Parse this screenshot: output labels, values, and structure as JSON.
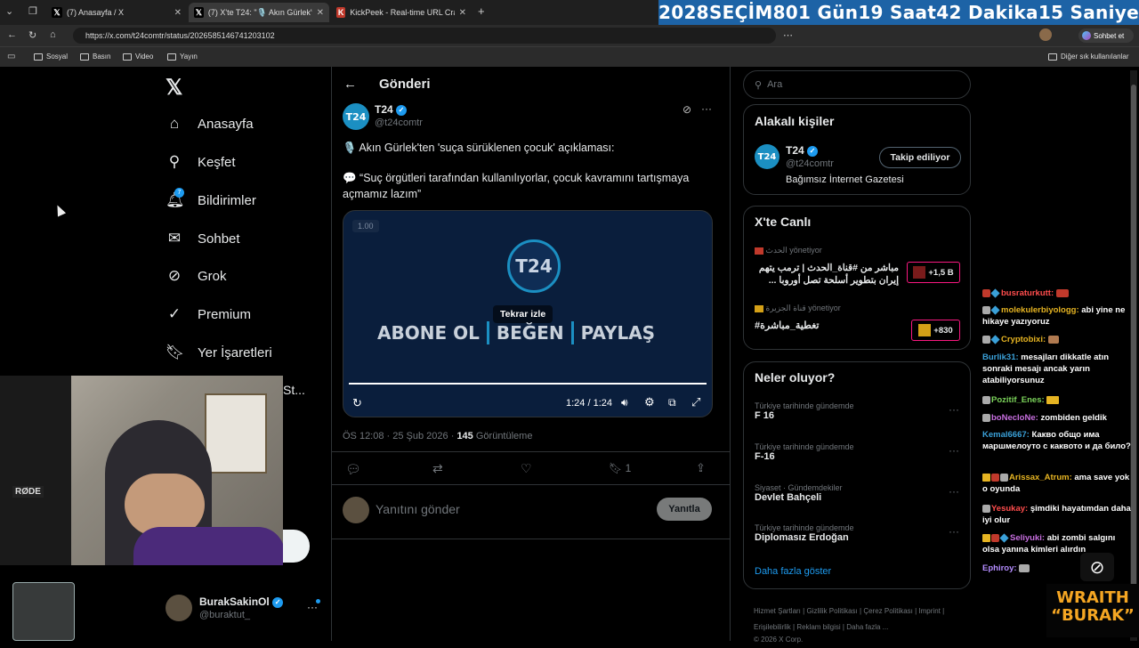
{
  "browser": {
    "tabs": [
      {
        "label": "(7) Anasayfa / X"
      },
      {
        "label": "(7) X'te T24: \"🎙️ Akın Gürlek'ten"
      },
      {
        "label": "KickPeek - Real-time URL Crawler"
      }
    ],
    "url": "https://x.com/t24comtr/status/2026585146741203102",
    "profile_button": "Sohbet et",
    "bookmarks": [
      "Sosyal",
      "Basın",
      "Video",
      "Yayın"
    ],
    "other_bookmarks": "Diğer sık kullanılanlar"
  },
  "countdown": {
    "year": "2028",
    "label": "SEÇİM",
    "days": "801 Gün",
    "hours": "19 Saat",
    "minutes": "42 Dakika",
    "seconds": "15 Saniye"
  },
  "sidebar": {
    "items": [
      {
        "label": "Anasayfa",
        "icon": "home-icon"
      },
      {
        "label": "Keşfet",
        "icon": "search-icon"
      },
      {
        "label": "Bildirimler",
        "icon": "bell-icon",
        "badge": "7"
      },
      {
        "label": "Sohbet",
        "icon": "mail-icon"
      },
      {
        "label": "Grok",
        "icon": "grok-icon"
      },
      {
        "label": "Premium",
        "icon": "premium-icon"
      },
      {
        "label": "Yer İşaretleri",
        "icon": "bookmark-icon"
      }
    ],
    "partial_item": "St...",
    "account_name": "BurakSakinOl",
    "account_handle": "@buraktut_"
  },
  "post": {
    "header": "Gönderi",
    "author_name": "T24",
    "author_handle": "@t24comtr",
    "text_line1": "🎙️ Akın Gürlek'ten 'suça sürüklenen çocuk' açıklaması:",
    "text_line2": "💬 “Suç örgütleri tarafından kullanılıyorlar, çocuk kavramını tartışmaya açmamız lazım”",
    "video": {
      "speed": "1.00",
      "logo": "T24",
      "replay_tooltip": "Tekrar izle",
      "cta1": "ABONE OL",
      "cta2": "BEĞEN",
      "cta3": "PAYLAŞ",
      "time": "1:24 / 1:24",
      "progress": 1.0
    },
    "timestamp": "ÖS 12:08 · 25 Şub 2026 ·",
    "views_count": "145",
    "views_label": "Görüntüleme",
    "bookmark_count": "1",
    "reply_placeholder": "Yanıtını gönder",
    "reply_button": "Yanıtla"
  },
  "right": {
    "search_placeholder": "Ara",
    "related_title": "Alakalı kişiler",
    "related": {
      "name": "T24",
      "handle": "@t24comtr",
      "bio": "Bağımsız İnternet Gazetesi",
      "follow_label": "Takip ediliyor"
    },
    "live_title": "X'te Canlı",
    "live": [
      {
        "host": "الحدث",
        "status": "yönetiyor",
        "title": "مباشر من #قناة_الحدث | ترمب يتهم إيران بتطوير أسلحة تصل أوروبا ...",
        "count": "+1,5 B"
      },
      {
        "host": "قناة الجزيرة",
        "status": "yönetiyor",
        "title": "#تغطية_مباشرة",
        "count": "+830"
      }
    ],
    "trends_title": "Neler oluyor?",
    "trends": [
      {
        "category": "Türkiye tarihinde gündemde",
        "name": "F 16"
      },
      {
        "category": "Türkiye tarihinde gündemde",
        "name": "F-16"
      },
      {
        "category": "Siyaset · Gündemdekiler",
        "name": "Devlet Bahçeli"
      },
      {
        "category": "Türkiye tarihinde gündemde",
        "name": "Diplomasız Erdoğan"
      }
    ],
    "show_more": "Daha fazla göster",
    "footer": [
      "Hizmet Şartları",
      "Gizlilik Politikası",
      "Çerez Politikası",
      "Imprint",
      "Erişilebilirlik",
      "Reklam bilgisi",
      "Daha fazla ..."
    ],
    "copyright": "© 2026 X Corp."
  },
  "chat": [
    {
      "user": "busraturkutt:",
      "msg": "",
      "color": "#ff4d4d"
    },
    {
      "user": "molekulerbiyologg:",
      "msg": "abi yine ne hikaye yazıyoruz",
      "color": "#e6b422"
    },
    {
      "user": "Cryptobixi:",
      "msg": "",
      "color": "#e6b422"
    },
    {
      "user": "Burlik31:",
      "msg": "mesajları dikkatle atın sonraki mesajı ancak yarın atabiliyorsunuz",
      "color": "#3aa0d8"
    },
    {
      "user": "Pozitif_Enes:",
      "msg": "",
      "color": "#7bd35a"
    },
    {
      "user": "boNecloNe:",
      "msg": "zombiden geldik",
      "color": "#c86fe0"
    },
    {
      "user": "Kemal6667:",
      "msg": "Какво общо има маршмелоуто с каквото и да било?",
      "color": "#3aa0d8"
    },
    {
      "user": "Arissax_Atrum:",
      "msg": "ama save yok o oyunda",
      "color": "#e6b422"
    },
    {
      "user": "Yesukay:",
      "msg": "şimdiki hayatımdan daha iyi olur",
      "color": "#ff4d4d"
    },
    {
      "user": "Seliyuki:",
      "msg": "abi zombi salgını olsa yanına kimleri alırdın",
      "color": "#c86fe0"
    },
    {
      "user": "Ephiroy:",
      "msg": "",
      "color": "#b48cff"
    }
  ],
  "overlay_logo": {
    "line1": "WRAITH",
    "line2": "“BURAK”"
  },
  "webcam_label": "RØDE",
  "colors": {
    "accent": "#1d9bf0",
    "countdown_bg": "#1d63a6",
    "t24": "#1b8fc2",
    "video_bg": "#0a1e3c"
  }
}
